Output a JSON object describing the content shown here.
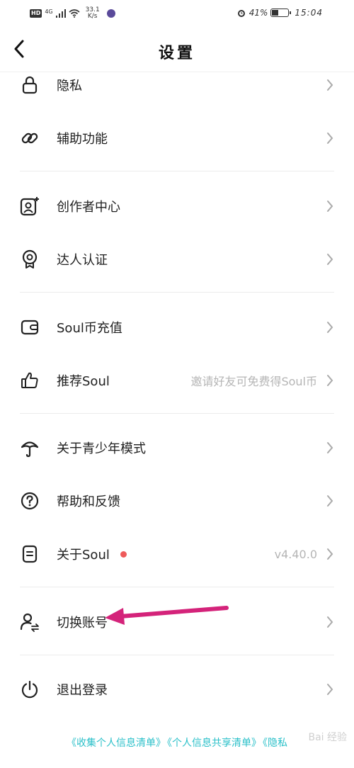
{
  "status_bar": {
    "hd": "HD",
    "network": "4G",
    "speed_value": "33.1",
    "speed_unit": "K/s",
    "battery": "41%",
    "battery_level": 0.41,
    "time": "15:04"
  },
  "header": {
    "title": "设置",
    "back_icon": "chevron-left-icon"
  },
  "items": [
    {
      "label": "隐私",
      "icon": "lock-icon",
      "value": ""
    },
    {
      "label": "辅助功能",
      "icon": "link-icon",
      "value": ""
    },
    {
      "label": "创作者中心",
      "icon": "creator-icon",
      "value": ""
    },
    {
      "label": "达人认证",
      "icon": "badge-icon",
      "value": ""
    },
    {
      "label": "Soul币充值",
      "icon": "wallet-icon",
      "value": ""
    },
    {
      "label": "推荐Soul",
      "icon": "thumbs-up-icon",
      "value": "邀请好友可免费得Soul币"
    },
    {
      "label": "关于青少年模式",
      "icon": "umbrella-icon",
      "value": ""
    },
    {
      "label": "帮助和反馈",
      "icon": "help-icon",
      "value": ""
    },
    {
      "label": "关于Soul",
      "icon": "document-icon",
      "value": "v4.40.0"
    },
    {
      "label": "切换账号",
      "icon": "switch-account-icon",
      "value": ""
    },
    {
      "label": "退出登录",
      "icon": "power-icon",
      "value": ""
    }
  ],
  "footer": {
    "link1": "《收集个人信息清单》",
    "link2": "《个人信息共享清单》",
    "link3": "《隐私",
    "watermark": "Bai 经验"
  },
  "colors": {
    "accent": "#2bc0c9",
    "annotation_arrow": "#d4237a",
    "badge_dot": "#ee5a5a"
  }
}
